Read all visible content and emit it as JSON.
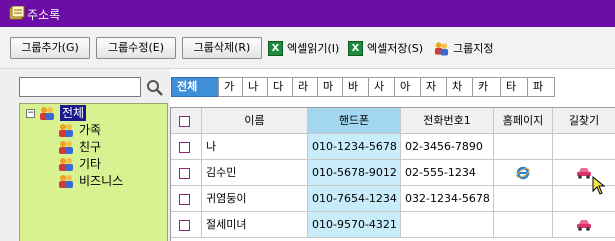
{
  "window": {
    "title": "주소록"
  },
  "toolbar": {
    "add_group": "그룹추가(G)",
    "edit_group": "그룹수정(E)",
    "delete_group": "그룹삭제(R)",
    "excel_read": "엑셀읽기(I)",
    "excel_save": "엑셀저장(S)",
    "assign_group": "그룹지정",
    "excel_glyph": "X"
  },
  "search": {
    "value": ""
  },
  "tree": {
    "expander": "−",
    "root": "전체",
    "children": [
      "가족",
      "친구",
      "기타",
      "비즈니스"
    ]
  },
  "tabs": [
    "전체",
    "가",
    "나",
    "다",
    "라",
    "마",
    "바",
    "사",
    "아",
    "자",
    "차",
    "카",
    "타",
    "파"
  ],
  "table": {
    "columns": [
      "",
      "이름",
      "핸드폰",
      "전화번호1",
      "홈페이지",
      "길찾기"
    ],
    "rows": [
      {
        "name": "나",
        "mobile": "010-1234-5678",
        "phone1": "02-3456-7890",
        "homepage": false,
        "directions": false
      },
      {
        "name": "김수민",
        "mobile": "010-5678-9012",
        "phone1": "02-555-1234",
        "homepage": true,
        "directions": true
      },
      {
        "name": "귀염둥이",
        "mobile": "010-7654-1234",
        "phone1": "032-1234-5678",
        "homepage": false,
        "directions": false
      },
      {
        "name": "절세미녀",
        "mobile": "010-9570-4321",
        "phone1": "",
        "homepage": false,
        "directions": true
      }
    ]
  },
  "colors": {
    "titlebar": "#6c0ea6",
    "active_tab": "#3f8fd8",
    "tree_bg": "#d9f291",
    "highlight_column": "#a3d7ef",
    "checkbox_border": "#8b2a6e"
  },
  "icons": [
    "addressbook-icon",
    "excel-icon",
    "group-icon",
    "search-icon",
    "ie-icon",
    "car-icon",
    "cursor-icon"
  ]
}
